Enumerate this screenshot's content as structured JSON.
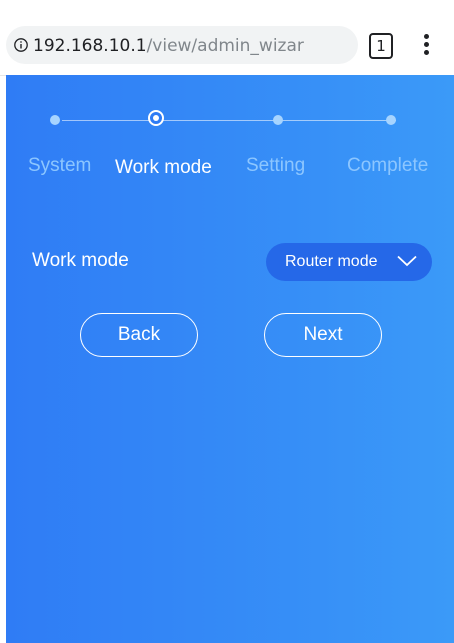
{
  "browser": {
    "url_host": "192.168.10.1",
    "url_path": "/view/admin_wizar",
    "tab_count": "1",
    "info_icon": "info-circle-icon",
    "menu_icon": "kebab-menu-icon"
  },
  "wizard": {
    "steps": [
      {
        "label": "System",
        "state": "inactive"
      },
      {
        "label": "Work mode",
        "state": "active"
      },
      {
        "label": "Setting",
        "state": "inactive"
      },
      {
        "label": "Complete",
        "state": "inactive"
      }
    ],
    "work_mode": {
      "label": "Work mode",
      "selected": "Router mode"
    },
    "back_label": "Back",
    "next_label": "Next"
  },
  "colors": {
    "background_start": "#2f7cf5",
    "background_end": "#3b9af8",
    "select_bg": "#2568e8",
    "inactive_step": "#8cc6ff",
    "active_step": "#ffffff"
  }
}
